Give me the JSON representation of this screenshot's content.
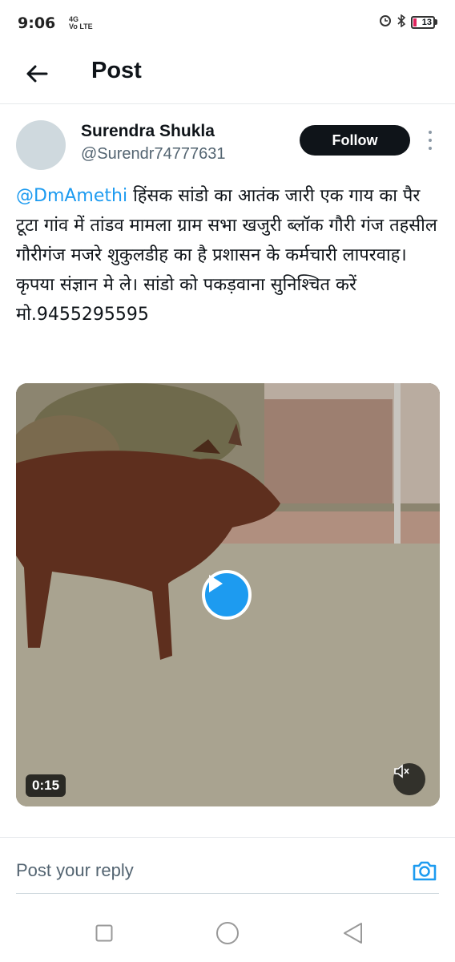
{
  "status_bar": {
    "time": "9:06",
    "network_top": "4G",
    "network_bottom": "Vo LTE",
    "battery": "13",
    "icons": [
      "signal-icon",
      "alarm-icon",
      "bluetooth-icon",
      "battery-icon"
    ]
  },
  "header": {
    "title": "Post",
    "back_icon": "arrow-left-icon"
  },
  "tweet": {
    "author_name": "Surendra Shukla",
    "author_handle": "@Surendr74777631",
    "follow_label": "Follow",
    "mention": "@DmAmethi",
    "text": " हिंसक सांडो का आतंक जारी एक गाय का पैर टूटा गांव में तांडव मामला ग्राम सभा खजुरी ब्लॉक गौरी गंज तहसील गौरीगंज मजरे शुकुलडीह का है प्रशासन के कर्मचारी लापरवाह। कृपया संज्ञान मे ले। सांडो को पकड़वाना सुनिश्चित करें मो.9455295595",
    "video": {
      "duration": "0:15",
      "play_icon": "play-icon",
      "mute_icon": "muted-speaker-icon"
    }
  },
  "reply": {
    "placeholder": "Post your reply",
    "camera_icon": "camera-icon"
  },
  "colors": {
    "accent": "#1d9bf0",
    "text": "#0f1419",
    "secondary": "#536471",
    "follow_bg": "#0f1419"
  }
}
